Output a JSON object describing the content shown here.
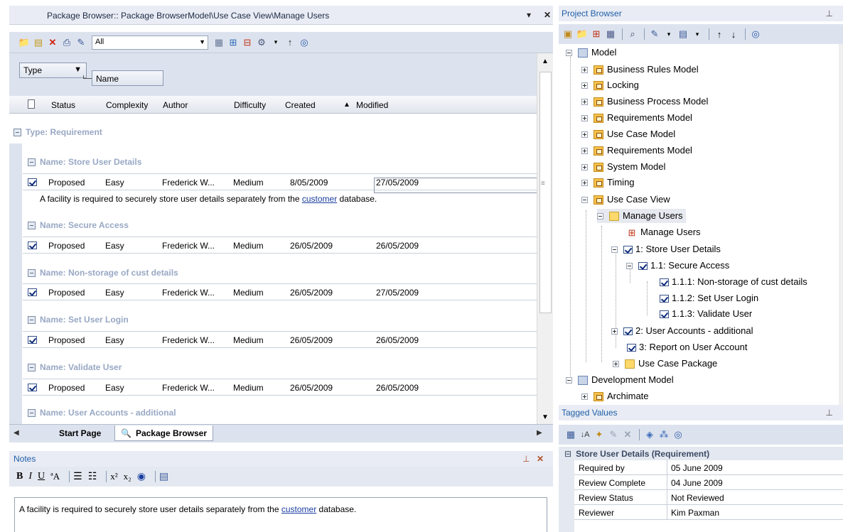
{
  "package_browser": {
    "title": "Package Browser:: Package BrowserModel\\Use Case View\\Manage Users",
    "filter_value": "All",
    "group_by": {
      "type": "Type",
      "name": "Name"
    },
    "columns": [
      "Status",
      "Complexity",
      "Author",
      "Difficulty",
      "Created",
      "Modified"
    ],
    "group_label": "Type: Requirement",
    "rows": [
      {
        "name": "Name: Store User Details",
        "status": "Proposed",
        "complexity": "Easy",
        "author": "Frederick W...",
        "difficulty": "Medium",
        "created": "8/05/2009",
        "modified": "27/05/2009",
        "note_pre": "A facility is required to securely store user details separately from the ",
        "note_link": "customer",
        "note_post": " database."
      },
      {
        "name": "Name: Secure Access",
        "status": "Proposed",
        "complexity": "Easy",
        "author": "Frederick W...",
        "difficulty": "Medium",
        "created": "26/05/2009",
        "modified": "26/05/2009"
      },
      {
        "name": "Name: Non-storage of cust details",
        "status": "Proposed",
        "complexity": "Easy",
        "author": "Frederick W...",
        "difficulty": "Medium",
        "created": "26/05/2009",
        "modified": "27/05/2009"
      },
      {
        "name": "Name: Set User Login",
        "status": "Proposed",
        "complexity": "Easy",
        "author": "Frederick W...",
        "difficulty": "Medium",
        "created": "26/05/2009",
        "modified": "26/05/2009"
      },
      {
        "name": "Name: Validate User",
        "status": "Proposed",
        "complexity": "Easy",
        "author": "Frederick W...",
        "difficulty": "Medium",
        "created": "26/05/2009",
        "modified": "26/05/2009"
      },
      {
        "name": "Name: User Accounts - additional"
      }
    ],
    "tabs": [
      "Start Page",
      "Package Browser"
    ]
  },
  "notes": {
    "title": "Notes",
    "text_pre": "A facility is required to securely store user details separately from the ",
    "text_link": "customer",
    "text_post": " database."
  },
  "project_browser": {
    "title": "Project Browser",
    "tree": [
      "Model",
      "Business Rules Model",
      "Locking",
      "Business Process Model",
      "Requirements Model",
      "Use Case Model",
      "Requirements Model",
      "System Model",
      "Timing",
      "Use Case View",
      "Manage Users",
      "Manage Users",
      "1: Store User Details",
      "1.1: Secure Access",
      "1.1.1: Non-storage of cust details",
      "1.1.2: Set User Login",
      "1.1.3: Validate User",
      "2: User Accounts - additional",
      "3: Report on User Account",
      "Use Case Package",
      "Development Model",
      "Archimate"
    ]
  },
  "tagged_values": {
    "title": "Tagged Values",
    "group": "Store User Details (Requirement)",
    "rows": [
      {
        "key": "Required by",
        "value": "05 June 2009"
      },
      {
        "key": "Review Complete",
        "value": "04 June 2009"
      },
      {
        "key": "Review Status",
        "value": "Not Reviewed"
      },
      {
        "key": "Reviewer",
        "value": "Kim Paxman"
      }
    ]
  },
  "colors": {
    "accent_title": "#1f5fa8",
    "group_text": "#98a8c4",
    "panel_bg": "#dde3ee",
    "link": "#1a3ea0"
  }
}
